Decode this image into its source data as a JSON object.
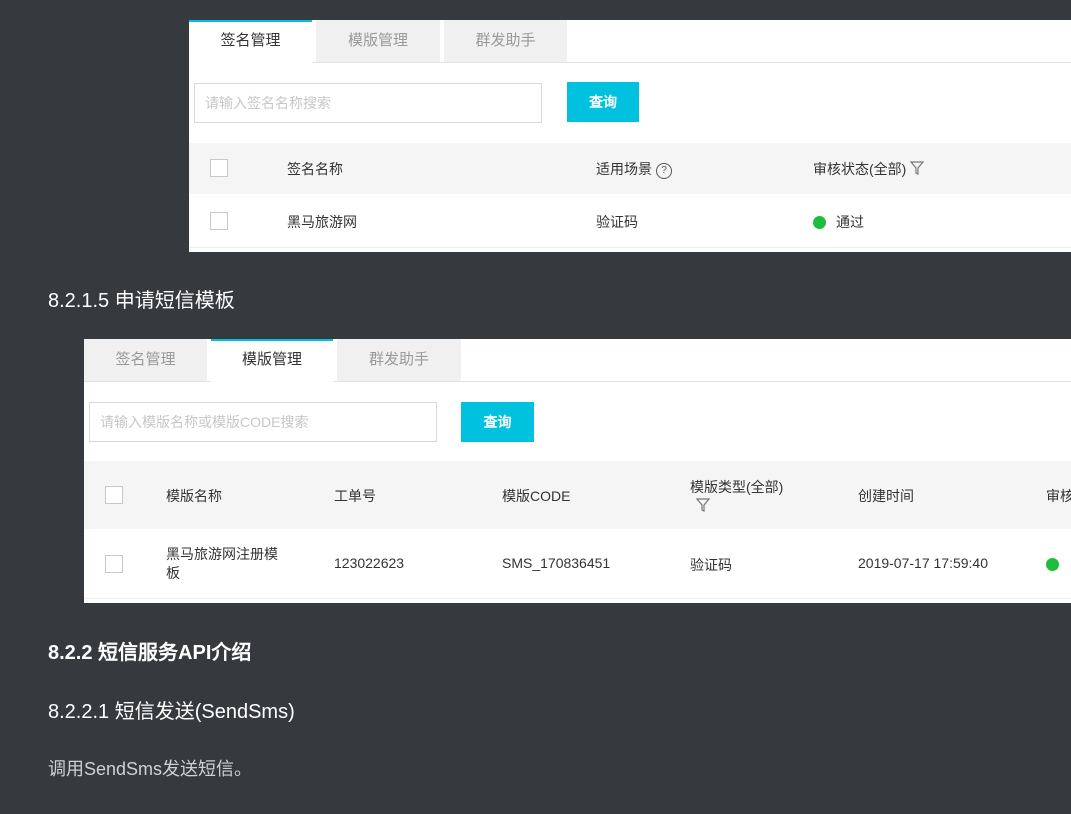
{
  "panel1": {
    "tabs": [
      "签名管理",
      "模版管理",
      "群发助手"
    ],
    "active_tab": 0,
    "search_placeholder": "请输入签名名称搜索",
    "query_button": "查询",
    "headers": {
      "name": "签名名称",
      "scene": "适用场景",
      "status": "审核状态(全部)"
    },
    "rows": [
      {
        "name": "黑马旅游网",
        "scene": "验证码",
        "status": "通过",
        "status_color": "#1ebe3b"
      }
    ]
  },
  "section_8215": "8.2.1.5 申请短信模板",
  "panel2": {
    "tabs": [
      "签名管理",
      "模版管理",
      "群发助手"
    ],
    "active_tab": 1,
    "search_placeholder": "请输入模版名称或模版CODE搜索",
    "query_button": "查询",
    "headers": {
      "name": "模版名称",
      "ticket": "工单号",
      "code": "模版CODE",
      "type": "模版类型(全部)",
      "created": "创建时间",
      "audit": "审核"
    },
    "rows": [
      {
        "name_line1": "黑马旅游网注册模",
        "name_line2": "板",
        "ticket": "123022623",
        "code": "SMS_170836451",
        "type": "验证码",
        "created": "2019-07-17 17:59:40",
        "status_color": "#1ebe3b"
      }
    ]
  },
  "section_822": "8.2.2 短信服务API介绍",
  "section_8221": "8.2.2.1 短信发送(SendSms)",
  "paragraph": "调用SendSms发送短信。",
  "accent_color": "#00c1de",
  "page_background": "#363a3f",
  "icons": [
    "help-icon",
    "filter-icon",
    "status-dot-icon"
  ]
}
